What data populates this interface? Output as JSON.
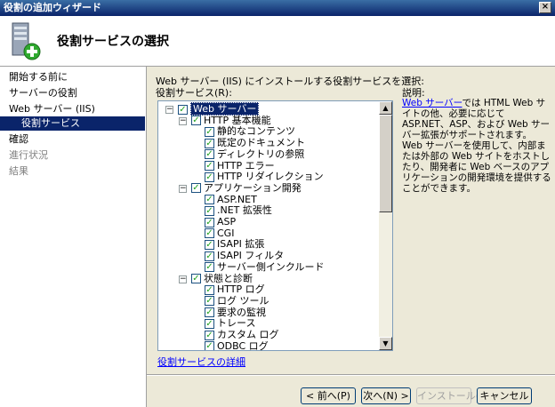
{
  "window": {
    "title": "役割の追加ウィザード",
    "close_label": "×"
  },
  "header": {
    "title": "役割サービスの選択",
    "icon": "server-add-icon"
  },
  "nav": {
    "items": [
      {
        "label": "開始する前に",
        "state": "normal"
      },
      {
        "label": "サーバーの役割",
        "state": "normal"
      },
      {
        "label": "Web サーバー (IIS)",
        "state": "normal"
      },
      {
        "label": "役割サービス",
        "state": "selected"
      },
      {
        "label": "確認",
        "state": "normal"
      },
      {
        "label": "進行状況",
        "state": "disabled"
      },
      {
        "label": "結果",
        "state": "disabled"
      }
    ]
  },
  "main": {
    "instruction": "Web サーバー (IIS) にインストールする役割サービスを選択:",
    "list_label": "役割サービス(R):",
    "more_link": "役割サービスの詳細",
    "description_title": "説明:",
    "description_link": "Web サーバー",
    "description_text": "では HTML Web サイトの他、必要に応じて ASP.NET、ASP、および Web サーバー拡張がサポートされます。Web サーバーを使用して、内部または外部の Web サイトをホストしたり、開発者に Web ベースのアプリケーションの開発環境を提供することができます。"
  },
  "tree": [
    {
      "label": "Web サーバー",
      "level": 0,
      "expander": "⊟",
      "checked": true,
      "selected": true
    },
    {
      "label": "HTTP 基本機能",
      "level": 1,
      "expander": "⊟",
      "checked": true
    },
    {
      "label": "静的なコンテンツ",
      "level": 2,
      "checked": true
    },
    {
      "label": "既定のドキュメント",
      "level": 2,
      "checked": true
    },
    {
      "label": "ディレクトリの参照",
      "level": 2,
      "checked": true
    },
    {
      "label": "HTTP エラー",
      "level": 2,
      "checked": true
    },
    {
      "label": "HTTP リダイレクション",
      "level": 2,
      "checked": true
    },
    {
      "label": "アプリケーション開発",
      "level": 1,
      "expander": "⊟",
      "checked": true
    },
    {
      "label": "ASP.NET",
      "level": 2,
      "checked": true
    },
    {
      "label": ".NET 拡張性",
      "level": 2,
      "checked": true
    },
    {
      "label": "ASP",
      "level": 2,
      "checked": true
    },
    {
      "label": "CGI",
      "level": 2,
      "checked": true
    },
    {
      "label": "ISAPI 拡張",
      "level": 2,
      "checked": true
    },
    {
      "label": "ISAPI フィルタ",
      "level": 2,
      "checked": true
    },
    {
      "label": "サーバー側インクルード",
      "level": 2,
      "checked": true
    },
    {
      "label": "状態と診断",
      "level": 1,
      "expander": "⊟",
      "checked": true
    },
    {
      "label": "HTTP ログ",
      "level": 2,
      "checked": true
    },
    {
      "label": "ログ ツール",
      "level": 2,
      "checked": true
    },
    {
      "label": "要求の監視",
      "level": 2,
      "checked": true
    },
    {
      "label": "トレース",
      "level": 2,
      "checked": true
    },
    {
      "label": "カスタム ログ",
      "level": 2,
      "checked": true
    },
    {
      "label": "ODBC ログ",
      "level": 2,
      "checked": true
    }
  ],
  "buttons": {
    "back": "< 前へ(P)",
    "next": "次へ(N) >",
    "install": "インストール(I)",
    "cancel": "キャンセル"
  },
  "colors": {
    "selection": "#0a246a",
    "check": "#21a121",
    "link": "#0000ff"
  }
}
